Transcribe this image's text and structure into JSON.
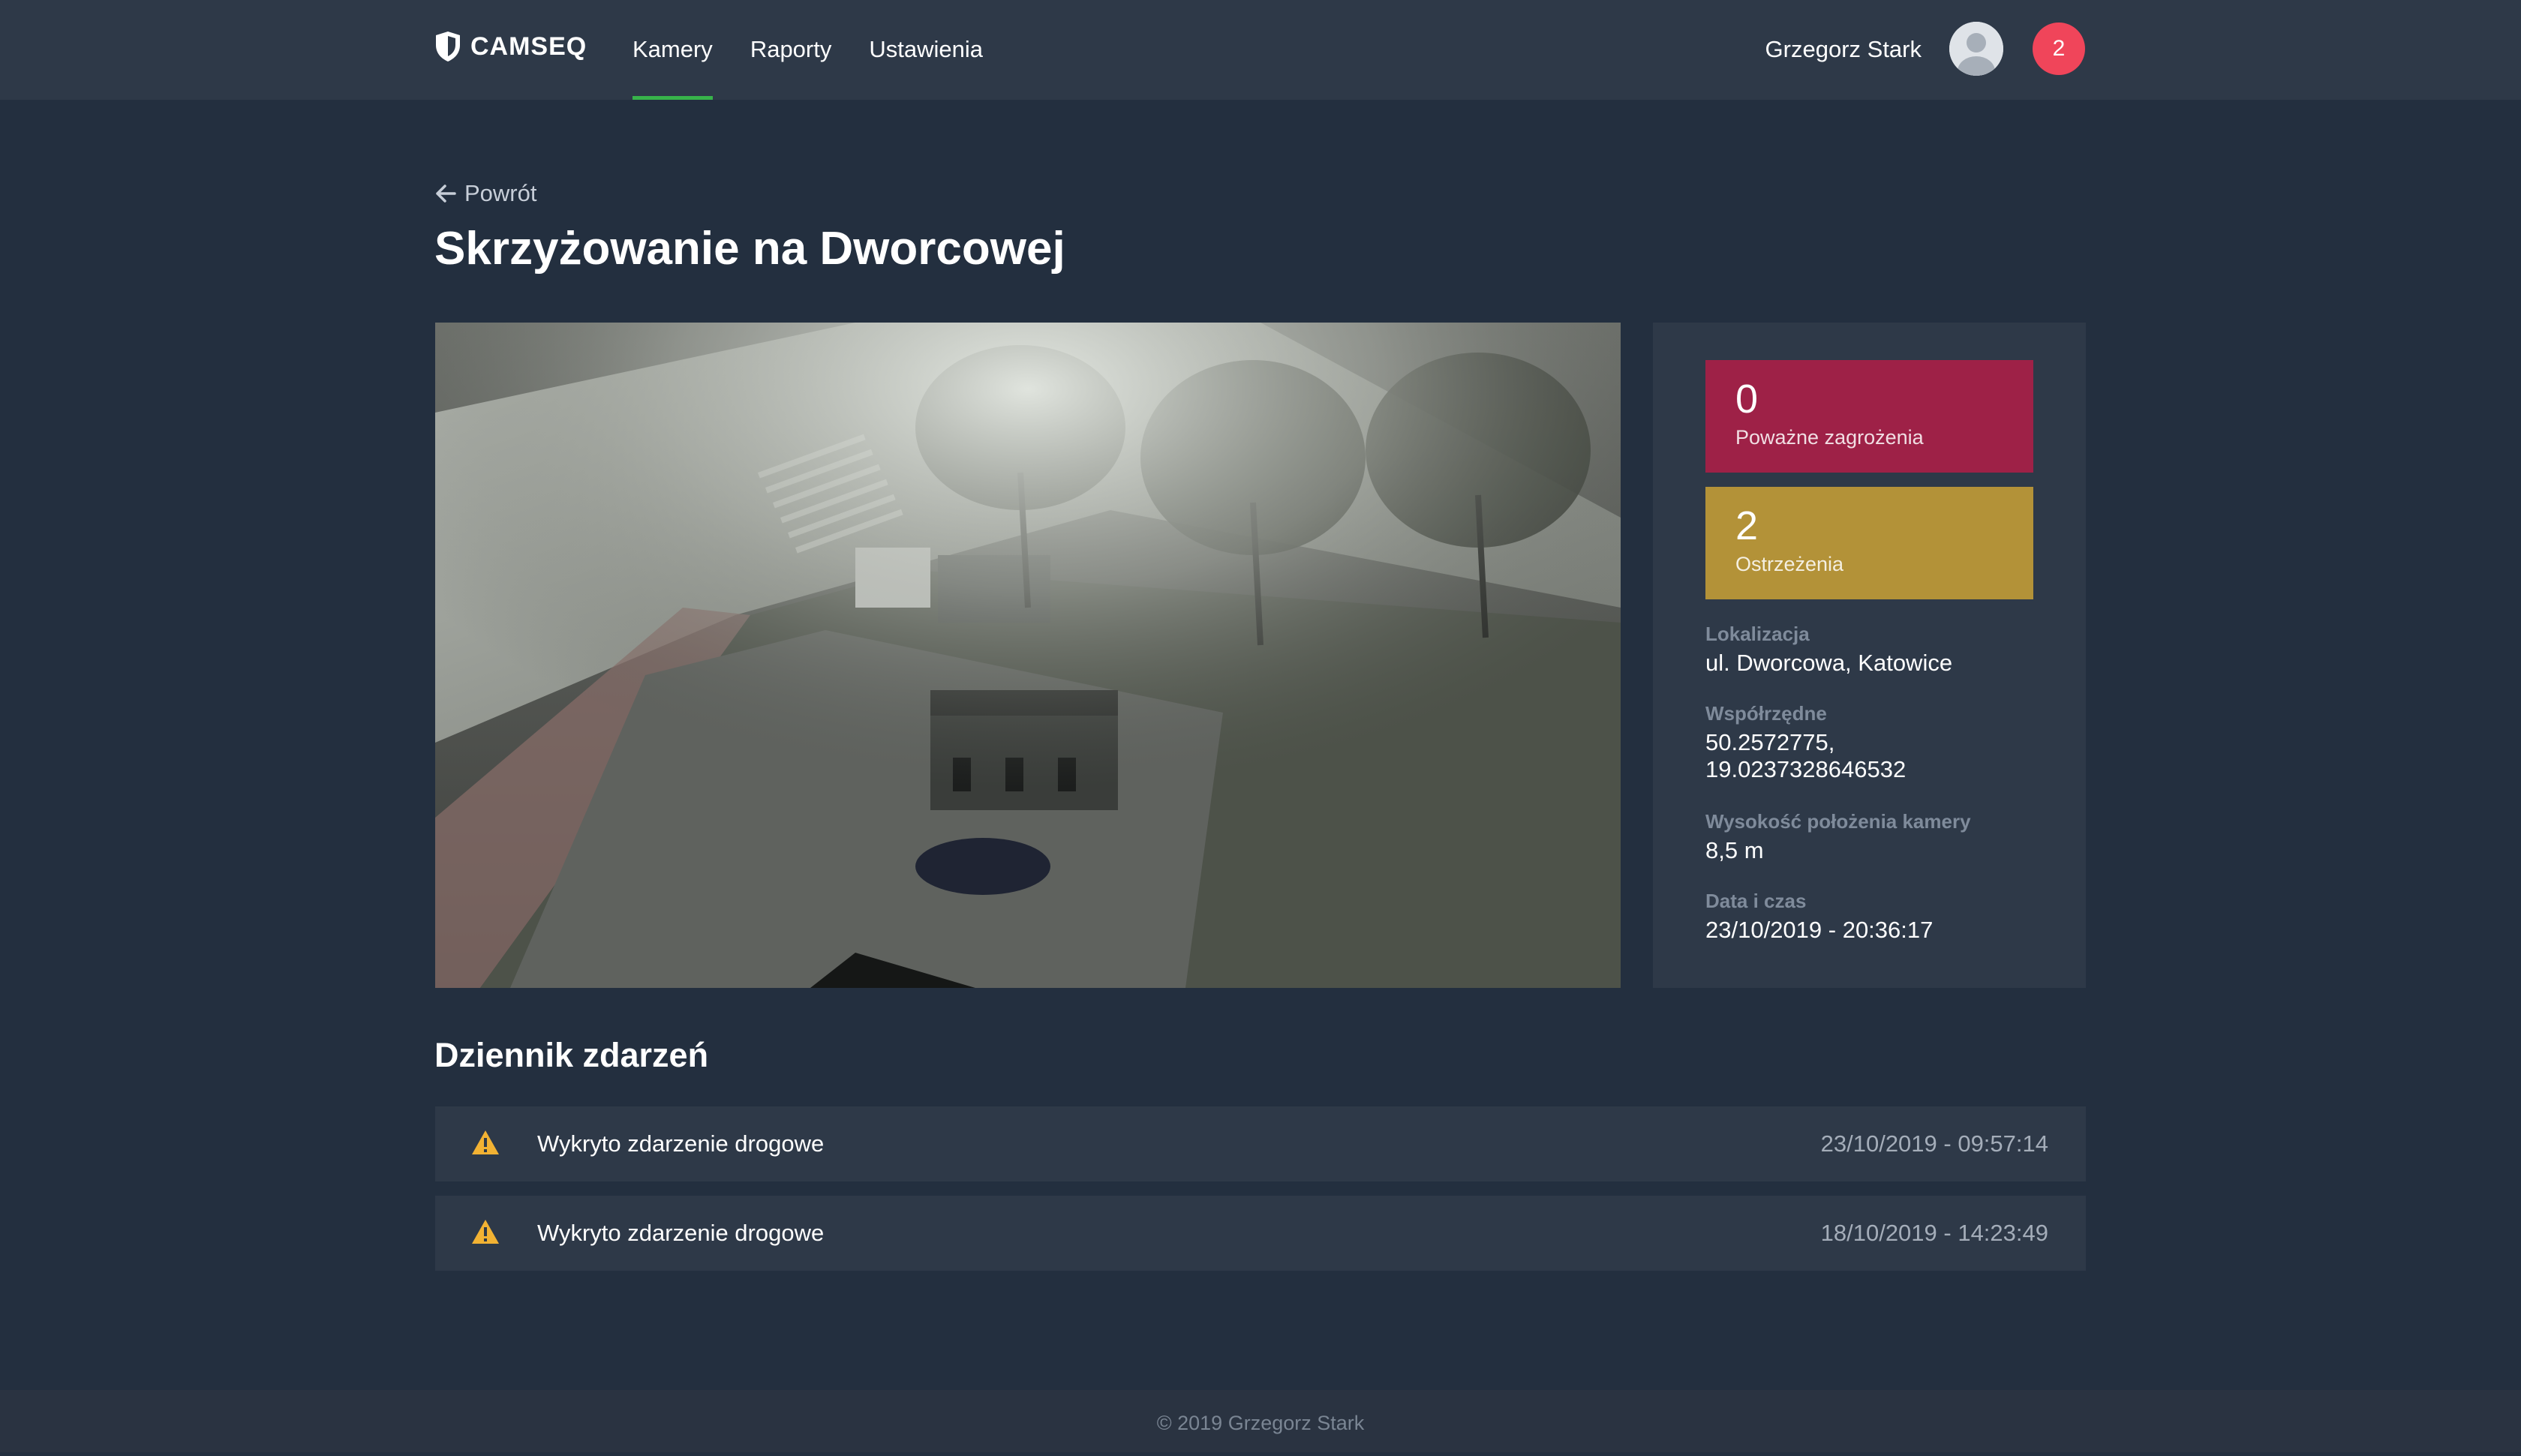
{
  "app": {
    "logo_text": "CAMSEQ",
    "nav": [
      {
        "label": "Kamery",
        "active": true
      },
      {
        "label": "Raporty",
        "active": false
      },
      {
        "label": "Ustawienia",
        "active": false
      }
    ],
    "user_name": "Grzegorz Stark",
    "notification_count": "2",
    "accent_color": "#37b34a"
  },
  "page": {
    "back_label": "Powrót",
    "title": "Skrzyżowanie na Dworcowej"
  },
  "stats": {
    "serious": {
      "value": "0",
      "label": "Poważne zagrożenia",
      "color": "#9e2147"
    },
    "warnings": {
      "value": "2",
      "label": "Ostrzeżenia",
      "color": "#b39238"
    }
  },
  "details": {
    "location_label": "Lokalizacja",
    "location_value": "ul. Dworcowa, Katowice",
    "coords_label": "Współrzędne",
    "coords_line1": "50.2572775,",
    "coords_line2": "19.0237328646532",
    "height_label": "Wysokość położenia kamery",
    "height_value": "8,5 m",
    "datetime_label": "Data i czas",
    "datetime_value": "23/10/2019 - 20:36:17"
  },
  "log": {
    "title": "Dziennik zdarzeń",
    "events": [
      {
        "icon": "warning-icon",
        "text": "Wykryto zdarzenie drogowe",
        "time": "23/10/2019 - 09:57:14"
      },
      {
        "icon": "warning-icon",
        "text": "Wykryto zdarzenie drogowe",
        "time": "18/10/2019 - 14:23:49"
      }
    ]
  },
  "footer": {
    "text": "© 2019 Grzegorz Stark"
  }
}
